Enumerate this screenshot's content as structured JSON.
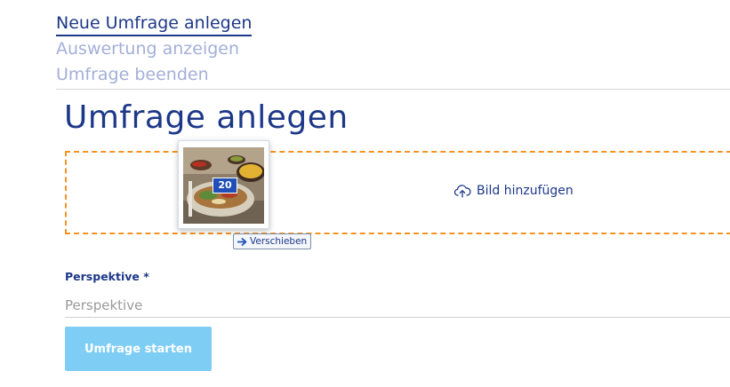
{
  "nav": {
    "items": [
      {
        "label": "Neue Umfrage anlegen",
        "active": true
      },
      {
        "label": "Auswertung anzeigen",
        "active": false
      },
      {
        "label": "Umfrage beenden",
        "active": false
      }
    ]
  },
  "page": {
    "title": "Umfrage anlegen"
  },
  "dropzone": {
    "upload_label": "Bild hinzufügen",
    "thumbnail": {
      "badge": "20"
    },
    "drag_tooltip": "Verschieben"
  },
  "form": {
    "perspective": {
      "label": "Perspektive *",
      "placeholder": "Perspektive",
      "value": ""
    },
    "start_button": "Umfrage starten"
  },
  "colors": {
    "brand": "#1d3888",
    "nav_inactive": "#a3afd8",
    "dropzone_border": "#f39321",
    "button_bg": "#7ecdf4",
    "badge_bg": "#1f4fb7"
  }
}
